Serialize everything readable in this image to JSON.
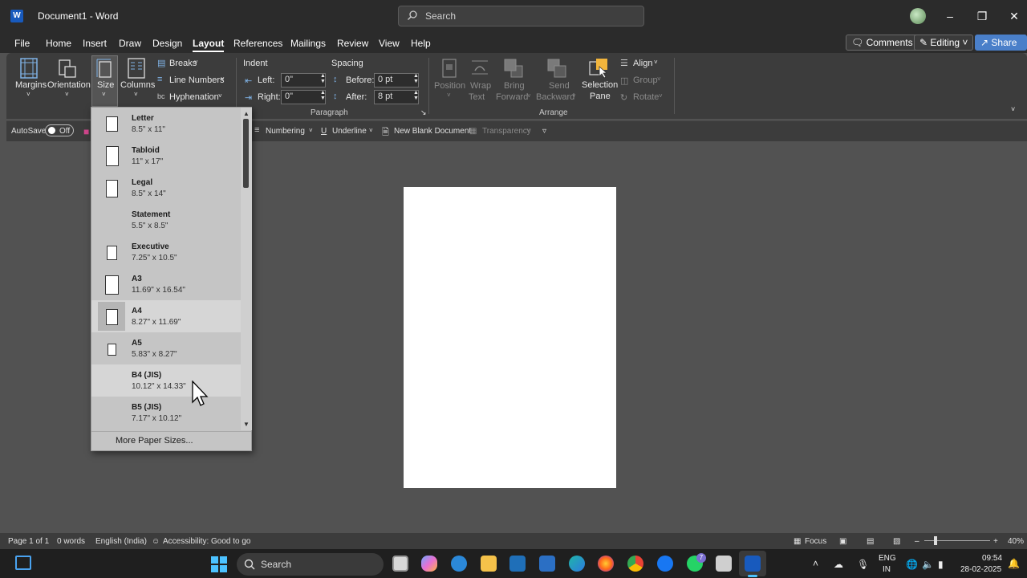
{
  "window": {
    "doc_title": "Document1 - Word",
    "search_placeholder": "Search"
  },
  "menu": [
    "File",
    "Home",
    "Insert",
    "Draw",
    "Design",
    "Layout",
    "References",
    "Mailings",
    "Review",
    "View",
    "Help"
  ],
  "header_buttons": {
    "comments": "Comments",
    "editing": "Editing",
    "share": "Share"
  },
  "ribbon": {
    "margins": "Margins",
    "orientation": "Orientation",
    "size": "Size",
    "columns": "Columns",
    "breaks": "Breaks",
    "line_numbers": "Line Numbers",
    "hyphenation": "Hyphenation",
    "indent": "Indent",
    "spacing": "Spacing",
    "left_label": "Left:",
    "left_value": "0\"",
    "right_label": "Right:",
    "right_value": "0\"",
    "before_label": "Before:",
    "before_value": "0 pt",
    "after_label": "After:",
    "after_value": "8 pt",
    "paragraph": "Paragraph",
    "position": "Position",
    "wrap_text_1": "Wrap",
    "wrap_text_2": "Text",
    "bring_forward_1": "Bring",
    "bring_forward_2": "Forward",
    "send_backward_1": "Send",
    "send_backward_2": "Backward",
    "selection_pane_1": "Selection",
    "selection_pane_2": "Pane",
    "align": "Align",
    "group": "Group",
    "rotate": "Rotate",
    "arrange": "Arrange"
  },
  "qat": {
    "autosave": "AutoSave",
    "autosave_state": "Off",
    "numbering": "Numbering",
    "underline": "Underline",
    "new_blank": "New Blank Document",
    "transparency": "Transparency"
  },
  "size_menu": {
    "items": [
      {
        "name": "Letter",
        "dims": "8.5\" x 11\""
      },
      {
        "name": "Tabloid",
        "dims": "11\" x 17\""
      },
      {
        "name": "Legal",
        "dims": "8.5\" x 14\""
      },
      {
        "name": "Statement",
        "dims": "5.5\" x 8.5\""
      },
      {
        "name": "Executive",
        "dims": "7.25\" x 10.5\""
      },
      {
        "name": "A3",
        "dims": "11.69\" x 16.54\""
      },
      {
        "name": "A4",
        "dims": "8.27\" x 11.69\""
      },
      {
        "name": "A5",
        "dims": "5.83\" x 8.27\""
      },
      {
        "name": "B4 (JIS)",
        "dims": "10.12\" x 14.33\""
      },
      {
        "name": "B5 (JIS)",
        "dims": "7.17\" x 10.12\""
      }
    ],
    "more": "More Paper Sizes..."
  },
  "status": {
    "page": "Page 1 of 1",
    "words": "0 words",
    "language": "English (India)",
    "accessibility": "Accessibility: Good to go",
    "focus": "Focus",
    "zoom": "40%"
  },
  "taskbar": {
    "search": "Search",
    "lang_1": "ENG",
    "lang_2": "IN",
    "time": "09:54",
    "date": "28-02-2025",
    "whatsapp_badge": "7"
  }
}
